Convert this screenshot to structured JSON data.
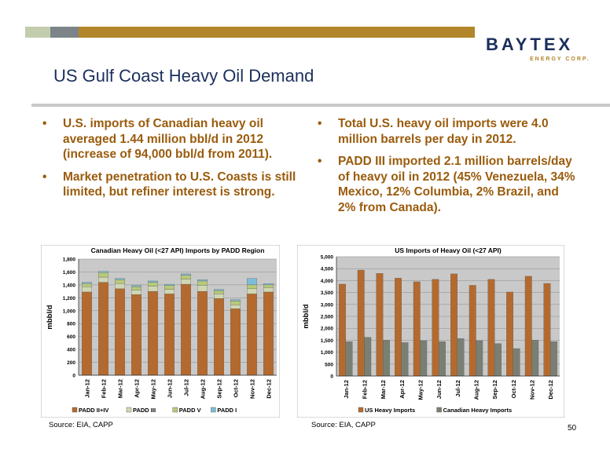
{
  "header": {
    "logo_main": "BAYTEX",
    "logo_sub": "ENERGY CORP.",
    "title": "US Gulf Coast Heavy Oil Demand"
  },
  "bullets_left": [
    "U.S. imports of Canadian heavy oil averaged 1.44 million bbl/d in 2012 (increase of 94,000 bbl/d from 2011).",
    "Market penetration to U.S. Coasts is still limited, but refiner interest is strong."
  ],
  "bullets_right": [
    "Total U.S. heavy oil imports were 4.0 million barrels per day in 2012.",
    "PADD III imported 2.1 million barrels/day of heavy oil in 2012 (45% Venezuela, 34% Mexico, 12% Columbia, 2% Brazil, and 2% from Canada)."
  ],
  "source_left": "Source: EIA, CAPP",
  "source_right": "Source: EIA, CAPP",
  "page_number": "50",
  "colors": {
    "padd2_4": "#b46a2e",
    "padd3": "#cfd7b4",
    "padd5": "#b8c97a",
    "padd1": "#7fbcd6",
    "us_heavy": "#b46a2e",
    "canadian_heavy": "#7a7f74",
    "plot_bg": "#c9c9c9"
  },
  "chart_data": [
    {
      "type": "bar",
      "stacked": true,
      "title": "Canadian Heavy Oil (<27 API) Imports by PADD Region",
      "ylabel": "mbbl/d",
      "xlabel": "",
      "ylim": [
        0,
        1800
      ],
      "yticks": [
        "0",
        "200",
        "400",
        "600",
        "800",
        "1,000",
        "1,200",
        "1,400",
        "1,600",
        "1,800"
      ],
      "categories": [
        "Jan-12",
        "Feb-12",
        "Mar-12",
        "Apr-12",
        "May-12",
        "Jun-12",
        "Jul-12",
        "Aug-12",
        "Sep-12",
        "Oct-12",
        "Nov-12",
        "Dec-12"
      ],
      "series": [
        {
          "name": "PADD II+IV",
          "values": [
            1290,
            1440,
            1340,
            1250,
            1300,
            1260,
            1410,
            1300,
            1190,
            1030,
            1260,
            1290
          ]
        },
        {
          "name": "PADD III",
          "values": [
            80,
            80,
            80,
            70,
            80,
            70,
            80,
            90,
            70,
            60,
            80,
            70
          ]
        },
        {
          "name": "PADD V",
          "values": [
            50,
            70,
            60,
            50,
            60,
            60,
            60,
            70,
            50,
            60,
            60,
            40
          ]
        },
        {
          "name": "PADD I",
          "values": [
            20,
            20,
            20,
            20,
            20,
            20,
            20,
            20,
            20,
            20,
            100,
            20
          ]
        }
      ],
      "legend_position": "bottom",
      "grid": true
    },
    {
      "type": "bar",
      "stacked": false,
      "title": "US Imports of Heavy Oil (<27 API)",
      "ylabel": "mbbl/d",
      "xlabel": "",
      "ylim": [
        0,
        5000
      ],
      "yticks": [
        "0",
        "500",
        "1,000",
        "1,500",
        "2,000",
        "2,500",
        "3,000",
        "3,500",
        "4,000",
        "4,500",
        "5,000"
      ],
      "categories": [
        "Jan-12",
        "Feb-12",
        "Mar-12",
        "Apr-12",
        "May-12",
        "Jun-12",
        "Jul-12",
        "Aug-12",
        "Sep-12",
        "Oct-12",
        "Nov-12",
        "Dec-12"
      ],
      "series": [
        {
          "name": "US Heavy Imports",
          "values": [
            3850,
            4440,
            4300,
            4100,
            3950,
            4050,
            4280,
            3800,
            4050,
            3520,
            4180,
            3880
          ]
        },
        {
          "name": "Canadian Heavy Imports",
          "values": [
            1440,
            1620,
            1500,
            1400,
            1480,
            1440,
            1570,
            1480,
            1360,
            1150,
            1500,
            1440
          ]
        }
      ],
      "legend_position": "bottom",
      "grid": true
    }
  ]
}
